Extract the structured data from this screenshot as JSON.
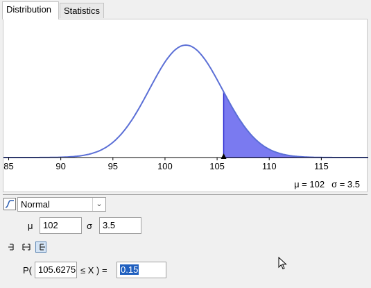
{
  "tabs": [
    {
      "label": "Distribution",
      "active": true
    },
    {
      "label": "Statistics",
      "active": false
    }
  ],
  "chart_data": {
    "type": "area",
    "distribution": "Normal",
    "mean": 102,
    "sd": 3.5,
    "xlim": [
      84.5,
      119.5
    ],
    "x_ticks": [
      "85",
      "90",
      "95",
      "100",
      "105",
      "110",
      "115"
    ],
    "shaded_from": 105.6275,
    "shaded_to": "infinity",
    "curve_color": "#5b6fd6",
    "fill_color": "#7a7af0"
  },
  "readout": {
    "mu": "μ = 102",
    "sigma": "σ = 3.5"
  },
  "distribution_select": {
    "value": "Normal",
    "icon": "normal-curve-icon"
  },
  "parameters": {
    "mu_label": "μ",
    "mu_value": "102",
    "sigma_label": "σ",
    "sigma_value": "3.5"
  },
  "interval_buttons": [
    {
      "icon": "left-sided-icon",
      "selected": false
    },
    {
      "icon": "interval-icon",
      "selected": false
    },
    {
      "icon": "right-sided-icon",
      "selected": true
    }
  ],
  "probability": {
    "prefix": "P(",
    "lower_value": "105.6275",
    "middle": "≤ X ) =",
    "result": "0.15"
  }
}
